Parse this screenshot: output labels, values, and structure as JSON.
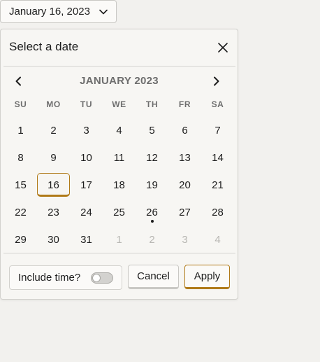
{
  "trigger": {
    "value": "January 16, 2023",
    "icon": "chevron-down-icon"
  },
  "popover": {
    "title": "Select a date",
    "close_icon": "close-icon"
  },
  "calendar": {
    "month_label": "JANUARY 2023",
    "prev_icon": "chevron-left-icon",
    "next_icon": "chevron-right-icon",
    "weekdays": [
      "SU",
      "MO",
      "TU",
      "WE",
      "TH",
      "FR",
      "SA"
    ],
    "weeks": [
      [
        "1",
        "2",
        "3",
        "4",
        "5",
        "6",
        "7"
      ],
      [
        "8",
        "9",
        "10",
        "11",
        "12",
        "13",
        "14"
      ],
      [
        "15",
        "16",
        "17",
        "18",
        "19",
        "20",
        "21"
      ],
      [
        "22",
        "23",
        "24",
        "25",
        "26",
        "27",
        "28"
      ],
      [
        "29",
        "30",
        "31",
        "1",
        "2",
        "3",
        "4"
      ]
    ],
    "selected": "16",
    "today": "26",
    "trailing_muted_count": 4,
    "accent_color": "#b07a18"
  },
  "footer": {
    "include_time_label": "Include time?",
    "include_time_on": false,
    "cancel_label": "Cancel",
    "apply_label": "Apply"
  }
}
